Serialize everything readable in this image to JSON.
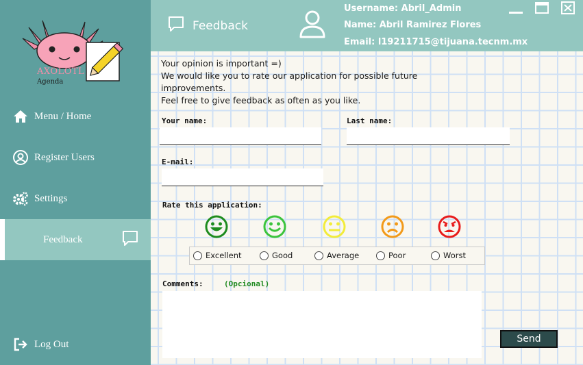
{
  "app": {
    "logo_title": "AXOLOTL",
    "logo_subtitle": "Agenda"
  },
  "sidebar": {
    "items": [
      {
        "label": "Menu / Home",
        "icon": "home-icon"
      },
      {
        "label": "Register Users",
        "icon": "user-circle-icon"
      },
      {
        "label": "Settings",
        "icon": "gears-icon"
      },
      {
        "label": "Feedback",
        "icon": "chat-icon",
        "active": true
      }
    ],
    "logout_label": "Log Out"
  },
  "header": {
    "title": "Feedback",
    "username": "Username: Abril_Admin",
    "name": "Name: Abril  Ramirez Flores",
    "email": "Email: l19211715@tijuana.tecnm.mx"
  },
  "intro": {
    "line1": "Your opinion is important =)",
    "line2": "We would like you to rate our application for possible future",
    "line3": "improvements.",
    "line4": "Feel free to give feedback as often as you like."
  },
  "form": {
    "your_name_label": "Your name:",
    "your_name_value": "",
    "last_name_label": "Last name:",
    "last_name_value": "",
    "email_label": "E-mail:",
    "email_value": "",
    "rate_label": "Rate this application:",
    "ratings": [
      {
        "label": "Excellent",
        "color": "#1e8c1e",
        "mood": "very-happy"
      },
      {
        "label": "Good",
        "color": "#3cc43c",
        "mood": "happy"
      },
      {
        "label": "Average",
        "color": "#f2ec3a",
        "mood": "neutral"
      },
      {
        "label": "Poor",
        "color": "#f29a1a",
        "mood": "sad"
      },
      {
        "label": "Worst",
        "color": "#e81c1c",
        "mood": "angry"
      }
    ],
    "comments_label": "Comments:",
    "comments_optional": "(Opcional)",
    "comments_value": "",
    "send_label": "Send"
  },
  "colors": {
    "sidebar": "#5e9f9e",
    "header": "#93c7c0",
    "accent_dark": "#2c4b4b"
  }
}
